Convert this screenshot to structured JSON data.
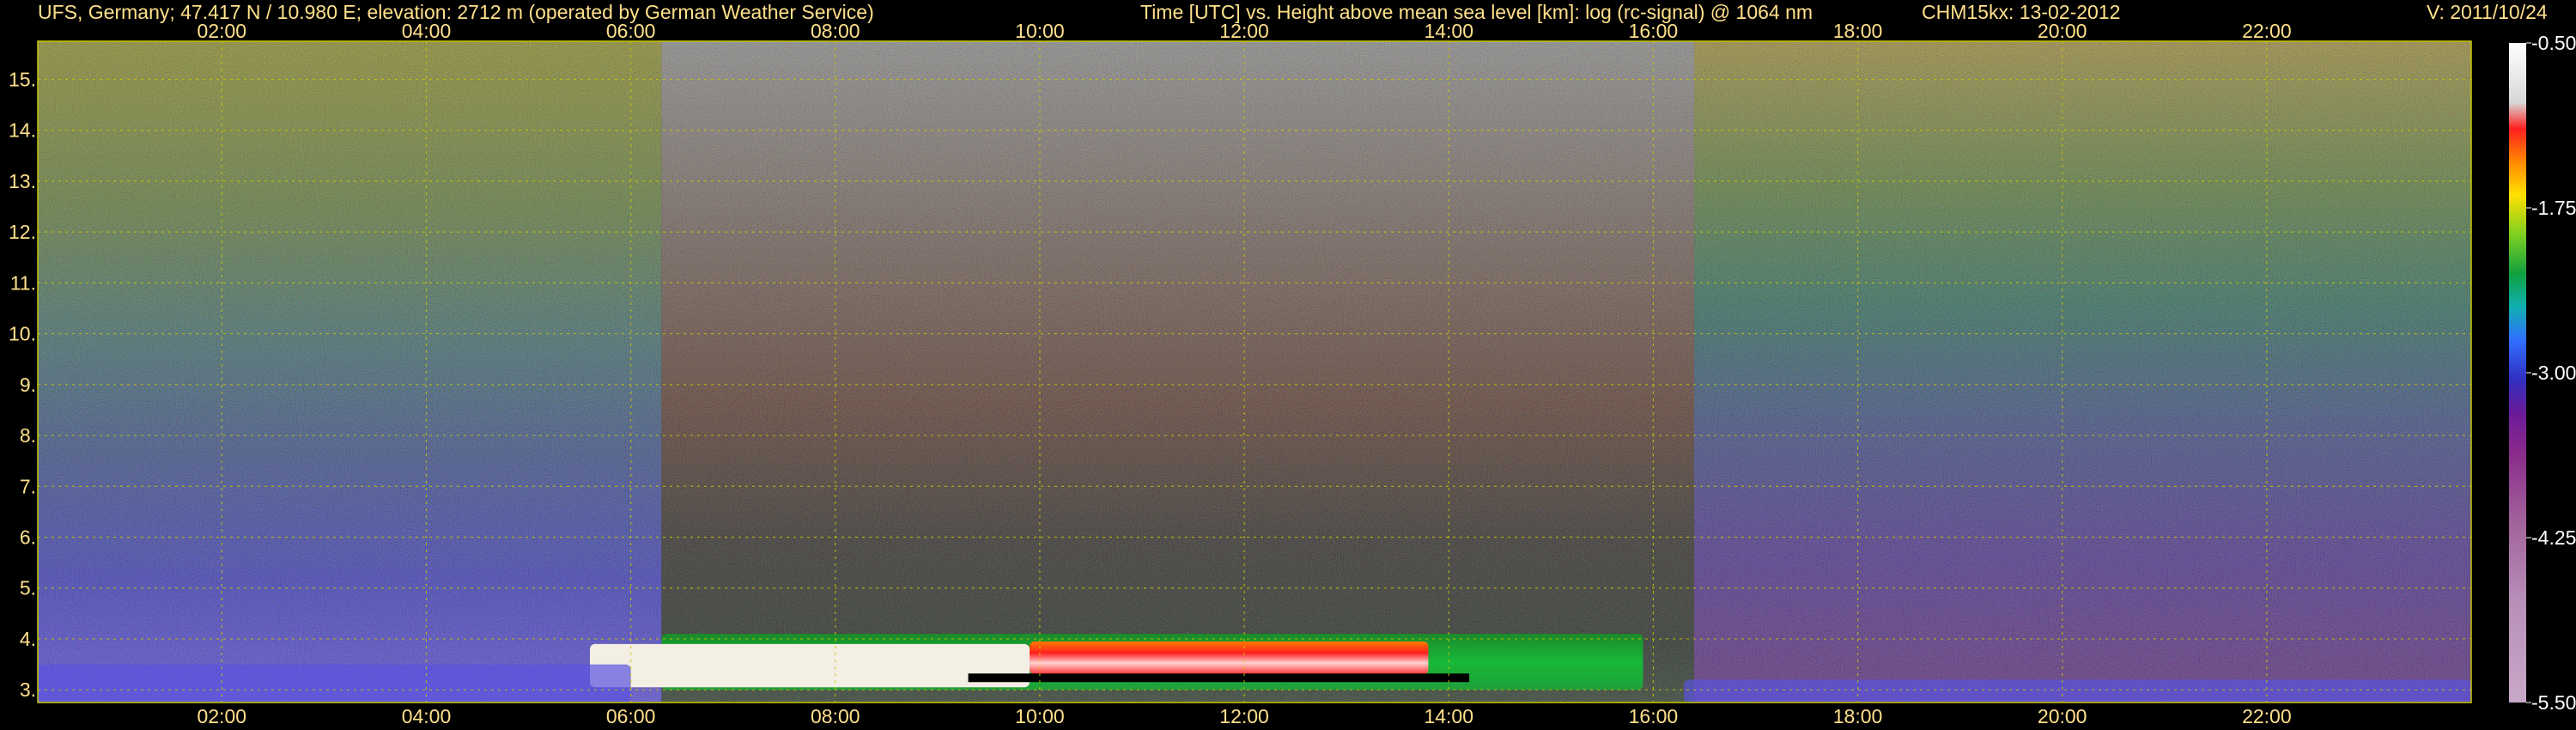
{
  "header": {
    "location": "UFS, Germany; 47.417 N / 10.980 E; elevation: 2712 m  (operated by German Weather Service)",
    "axes_title": "Time [UTC] vs. Height above mean sea level [km]: log (rc-signal) @ 1064 nm",
    "instrument_date": "CHM15kx: 13-02-2012",
    "version": "V: 2011/10/24"
  },
  "colors": {
    "background": "#000000",
    "grid": "#c8c800",
    "text": "#ffe08a",
    "colorbar_tick_text": "#ffffff"
  },
  "chart_data": {
    "type": "heatmap",
    "title": "Time [UTC] vs. Height above mean sea level [km]: log (rc-signal) @ 1064 nm",
    "xlabel": "Time [UTC]",
    "ylabel": "Height above mean sea level [km]",
    "x_ticks": [
      "02:00",
      "04:00",
      "06:00",
      "08:00",
      "10:00",
      "12:00",
      "14:00",
      "16:00",
      "18:00",
      "20:00",
      "22:00"
    ],
    "x_tick_hours": [
      2,
      4,
      6,
      8,
      10,
      12,
      14,
      16,
      18,
      20,
      22
    ],
    "xlim": [
      0.2,
      24.0
    ],
    "y_ticks": [
      "3.",
      "4.",
      "5.",
      "6.",
      "7.",
      "8.",
      "9.",
      "10.",
      "11.",
      "12.",
      "13.",
      "14.",
      "15."
    ],
    "y_tick_values": [
      3,
      4,
      5,
      6,
      7,
      8,
      9,
      10,
      11,
      12,
      13,
      14,
      15
    ],
    "ylim": [
      2.75,
      15.75
    ],
    "grid": true,
    "colorbar": {
      "label": "log (rc-signal)",
      "ticks": [
        "-0.50",
        "-1.75",
        "-3.00",
        "-4.25",
        "-5.50"
      ],
      "tick_values": [
        -0.5,
        -1.75,
        -3.0,
        -4.25,
        -5.5
      ],
      "range": [
        -5.5,
        -0.5
      ]
    },
    "features": [
      {
        "type": "noise_day",
        "t_start": 6.3,
        "t_end": 16.4,
        "h_bottom": 4.0,
        "h_top": 15.75
      },
      {
        "type": "planetary_boundary_layer",
        "t_start": 6.3,
        "t_end": 15.9,
        "h_bottom": 3.0,
        "h_top": 4.1
      },
      {
        "type": "aerosol_layer_core",
        "t_start": 9.9,
        "t_end": 13.8,
        "h_bottom": 3.3,
        "h_top": 3.95
      },
      {
        "type": "cloud_base_layer",
        "t_start": 5.6,
        "t_end": 9.9,
        "h_bottom": 3.05,
        "h_top": 3.9
      },
      {
        "type": "night_low_layer",
        "t_start": 0.2,
        "t_end": 6.0,
        "h_bottom": 2.75,
        "h_top": 3.5
      },
      {
        "type": "night_low_layer",
        "t_start": 16.3,
        "t_end": 24.0,
        "h_bottom": 2.75,
        "h_top": 3.2
      }
    ]
  }
}
